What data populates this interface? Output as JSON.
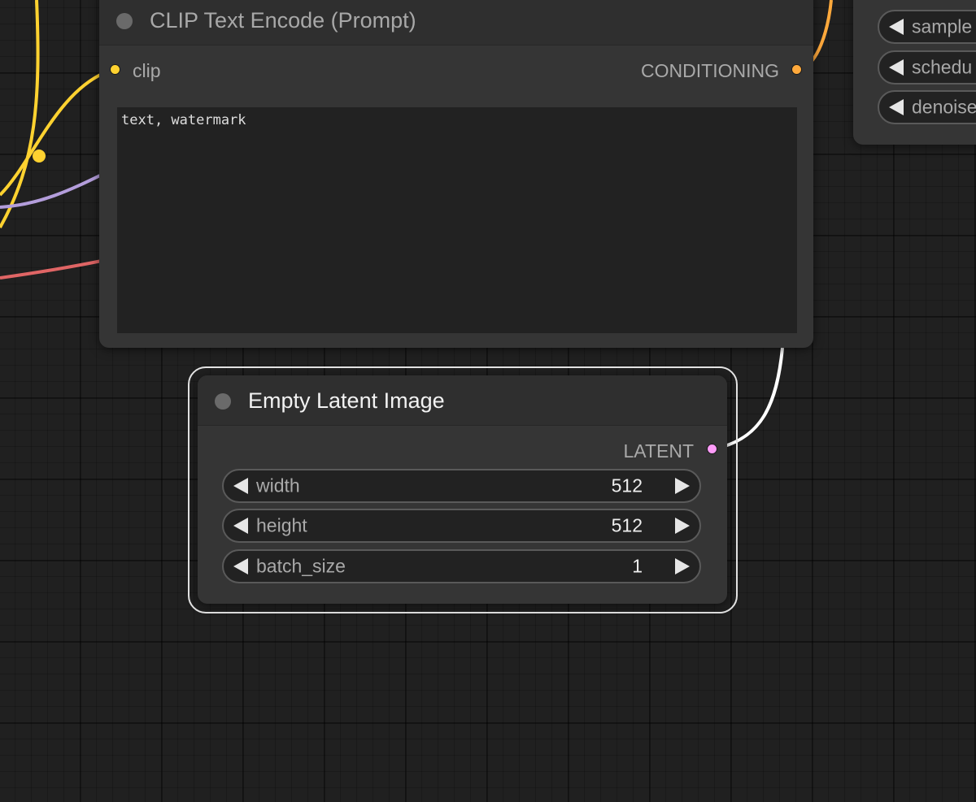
{
  "colors": {
    "clip_slot": "#ffd230",
    "conditioning_slot": "#ffa93c",
    "latent_slot": "#ff9cf9",
    "clip_link": "#ffd230",
    "model_link": "#b39ddb",
    "vae_link": "#e06565",
    "latent_link": "#ffffff",
    "canvas_bg": "#202020"
  },
  "clip_text_encode": {
    "title": "CLIP Text Encode (Prompt)",
    "input_label": "clip",
    "output_label": "CONDITIONING",
    "prompt_text": "text, watermark"
  },
  "empty_latent_image": {
    "title": "Empty Latent Image",
    "output_label": "LATENT",
    "widgets": [
      {
        "label": "width",
        "value": "512"
      },
      {
        "label": "height",
        "value": "512"
      },
      {
        "label": "batch_size",
        "value": "1"
      }
    ]
  },
  "ksampler_partial": {
    "widgets": [
      {
        "label": "sample"
      },
      {
        "label": "schedu"
      },
      {
        "label": "denoise"
      }
    ]
  }
}
